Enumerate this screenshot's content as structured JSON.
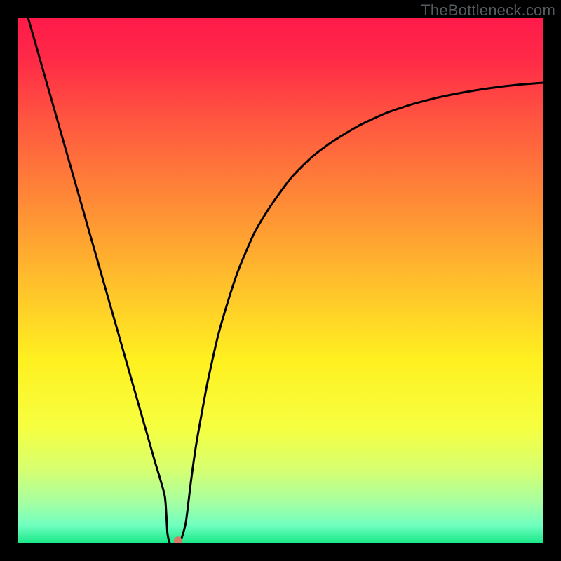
{
  "watermark": "TheBottleneck.com",
  "chart_data": {
    "type": "line",
    "title": "",
    "xlabel": "",
    "ylabel": "",
    "xlim": [
      0,
      100
    ],
    "ylim": [
      0,
      100
    ],
    "background_gradient": {
      "stops": [
        {
          "offset": 0.0,
          "color": "#ff1a4a"
        },
        {
          "offset": 0.08,
          "color": "#ff2a47"
        },
        {
          "offset": 0.2,
          "color": "#ff5840"
        },
        {
          "offset": 0.35,
          "color": "#ff8a36"
        },
        {
          "offset": 0.5,
          "color": "#ffbe2c"
        },
        {
          "offset": 0.65,
          "color": "#fff020"
        },
        {
          "offset": 0.78,
          "color": "#f6ff40"
        },
        {
          "offset": 0.86,
          "color": "#d6ff70"
        },
        {
          "offset": 0.92,
          "color": "#a8ffa0"
        },
        {
          "offset": 0.965,
          "color": "#70ffc0"
        },
        {
          "offset": 1.0,
          "color": "#18e888"
        }
      ]
    },
    "series": [
      {
        "name": "bottleneck-curve",
        "x": [
          2,
          4,
          6,
          8,
          10,
          12,
          14,
          16,
          18,
          20,
          22,
          24,
          26,
          28,
          28.5,
          29,
          30,
          31,
          32,
          33,
          34,
          36,
          38,
          40,
          42,
          45,
          48,
          52,
          56,
          60,
          65,
          70,
          75,
          80,
          85,
          90,
          95,
          100
        ],
        "y": [
          100,
          93,
          86,
          79,
          72,
          65,
          58,
          51,
          44,
          37,
          30,
          23,
          16,
          9,
          2,
          0,
          0,
          0.5,
          4,
          12,
          19,
          30,
          39,
          46,
          52,
          59,
          64,
          69.5,
          73.5,
          76.5,
          79.5,
          81.8,
          83.5,
          84.8,
          85.8,
          86.6,
          87.2,
          87.6
        ]
      }
    ],
    "marker": {
      "x": 30.5,
      "y": 0.5,
      "color": "#d47a66",
      "radius": 6
    }
  }
}
